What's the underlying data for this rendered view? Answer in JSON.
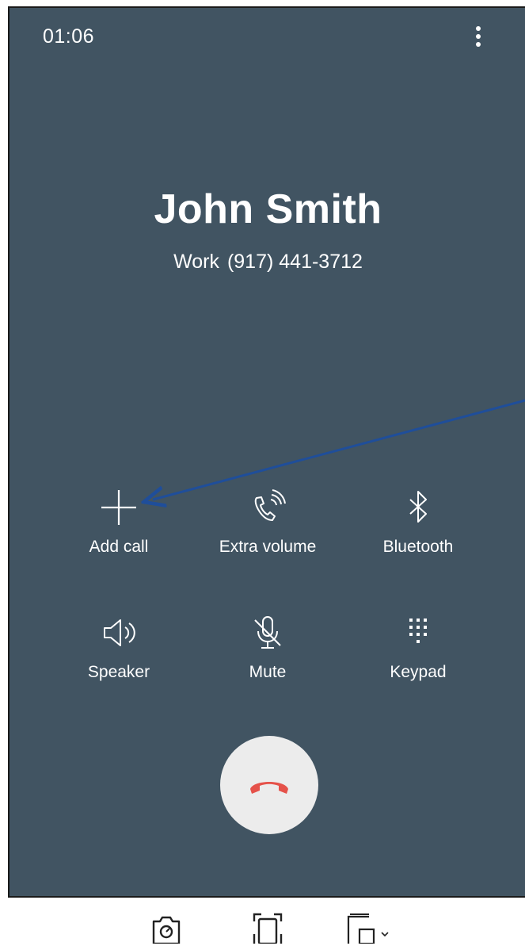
{
  "status_bar": {
    "time": "01:06"
  },
  "menu": {
    "icon": "more-vert-icon"
  },
  "contact": {
    "name": "John Smith",
    "label": "Work",
    "number": "(917) 441-3712"
  },
  "actions": [
    {
      "label": "Add call",
      "icon": "plus-icon"
    },
    {
      "label": "Extra volume",
      "icon": "phone-volume-icon"
    },
    {
      "label": "Bluetooth",
      "icon": "bluetooth-icon"
    },
    {
      "label": "Speaker",
      "icon": "speaker-icon"
    },
    {
      "label": "Mute",
      "icon": "mic-off-icon"
    },
    {
      "label": "Keypad",
      "icon": "dialpad-icon"
    }
  ],
  "end_call": {
    "icon": "hang-up-icon",
    "color": "#e5524a"
  },
  "colors": {
    "screen_bg": "#415462",
    "text": "#ffffff",
    "annotation_arrow": "#1f4e9a"
  },
  "bottom_toolbar": {
    "icons": [
      "camera-icon",
      "screenshot-frame-icon",
      "window-switch-icon"
    ]
  }
}
